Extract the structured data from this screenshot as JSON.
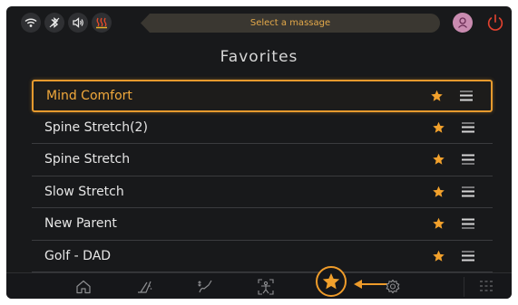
{
  "topbar": {
    "message_placeholder": "Select a massage",
    "icons": [
      "wifi-icon",
      "bluetooth-icon",
      "speaker-icon",
      "heat-icon"
    ],
    "user": "user-avatar-icon",
    "power": "power-icon"
  },
  "page": {
    "title": "Favorites"
  },
  "favorites": [
    {
      "label": "Mind Comfort",
      "selected": true
    },
    {
      "label": "Spine Stretch(2)",
      "selected": false
    },
    {
      "label": "Spine Stretch",
      "selected": false
    },
    {
      "label": "Slow Stretch",
      "selected": false
    },
    {
      "label": "New Parent",
      "selected": false
    },
    {
      "label": "Golf - DAD",
      "selected": false
    }
  ],
  "bottom_nav": {
    "items": [
      "home-icon",
      "recline-icon",
      "stretch-icon",
      "body-scan-icon",
      "favorites-icon",
      "settings-icon"
    ],
    "active": "favorites-icon"
  },
  "colors": {
    "accent": "#ee9b2a",
    "background": "#18191b",
    "text": "#e6e6e6"
  }
}
